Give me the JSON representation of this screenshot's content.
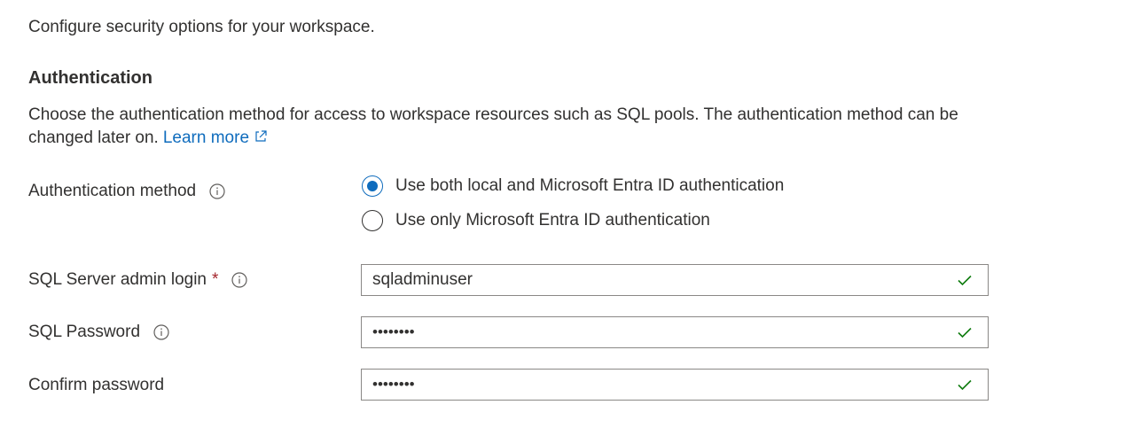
{
  "intro": "Configure security options for your workspace.",
  "section_title": "Authentication",
  "description": "Choose the authentication method for access to workspace resources such as SQL pools. The authentication method can be changed later on.",
  "learn_more": "Learn more",
  "auth_method": {
    "label": "Authentication method",
    "options": [
      {
        "label": "Use both local and Microsoft Entra ID authentication",
        "selected": true
      },
      {
        "label": "Use only Microsoft Entra ID authentication",
        "selected": false
      }
    ]
  },
  "admin_login": {
    "label": "SQL Server admin login",
    "required_mark": "*",
    "value": "sqladminuser"
  },
  "password": {
    "label": "SQL Password",
    "value": "••••••••"
  },
  "confirm_password": {
    "label": "Confirm password",
    "value": "••••••••"
  },
  "colors": {
    "accent": "#0f6cbd",
    "valid": "#107c10",
    "required": "#a4262c"
  }
}
